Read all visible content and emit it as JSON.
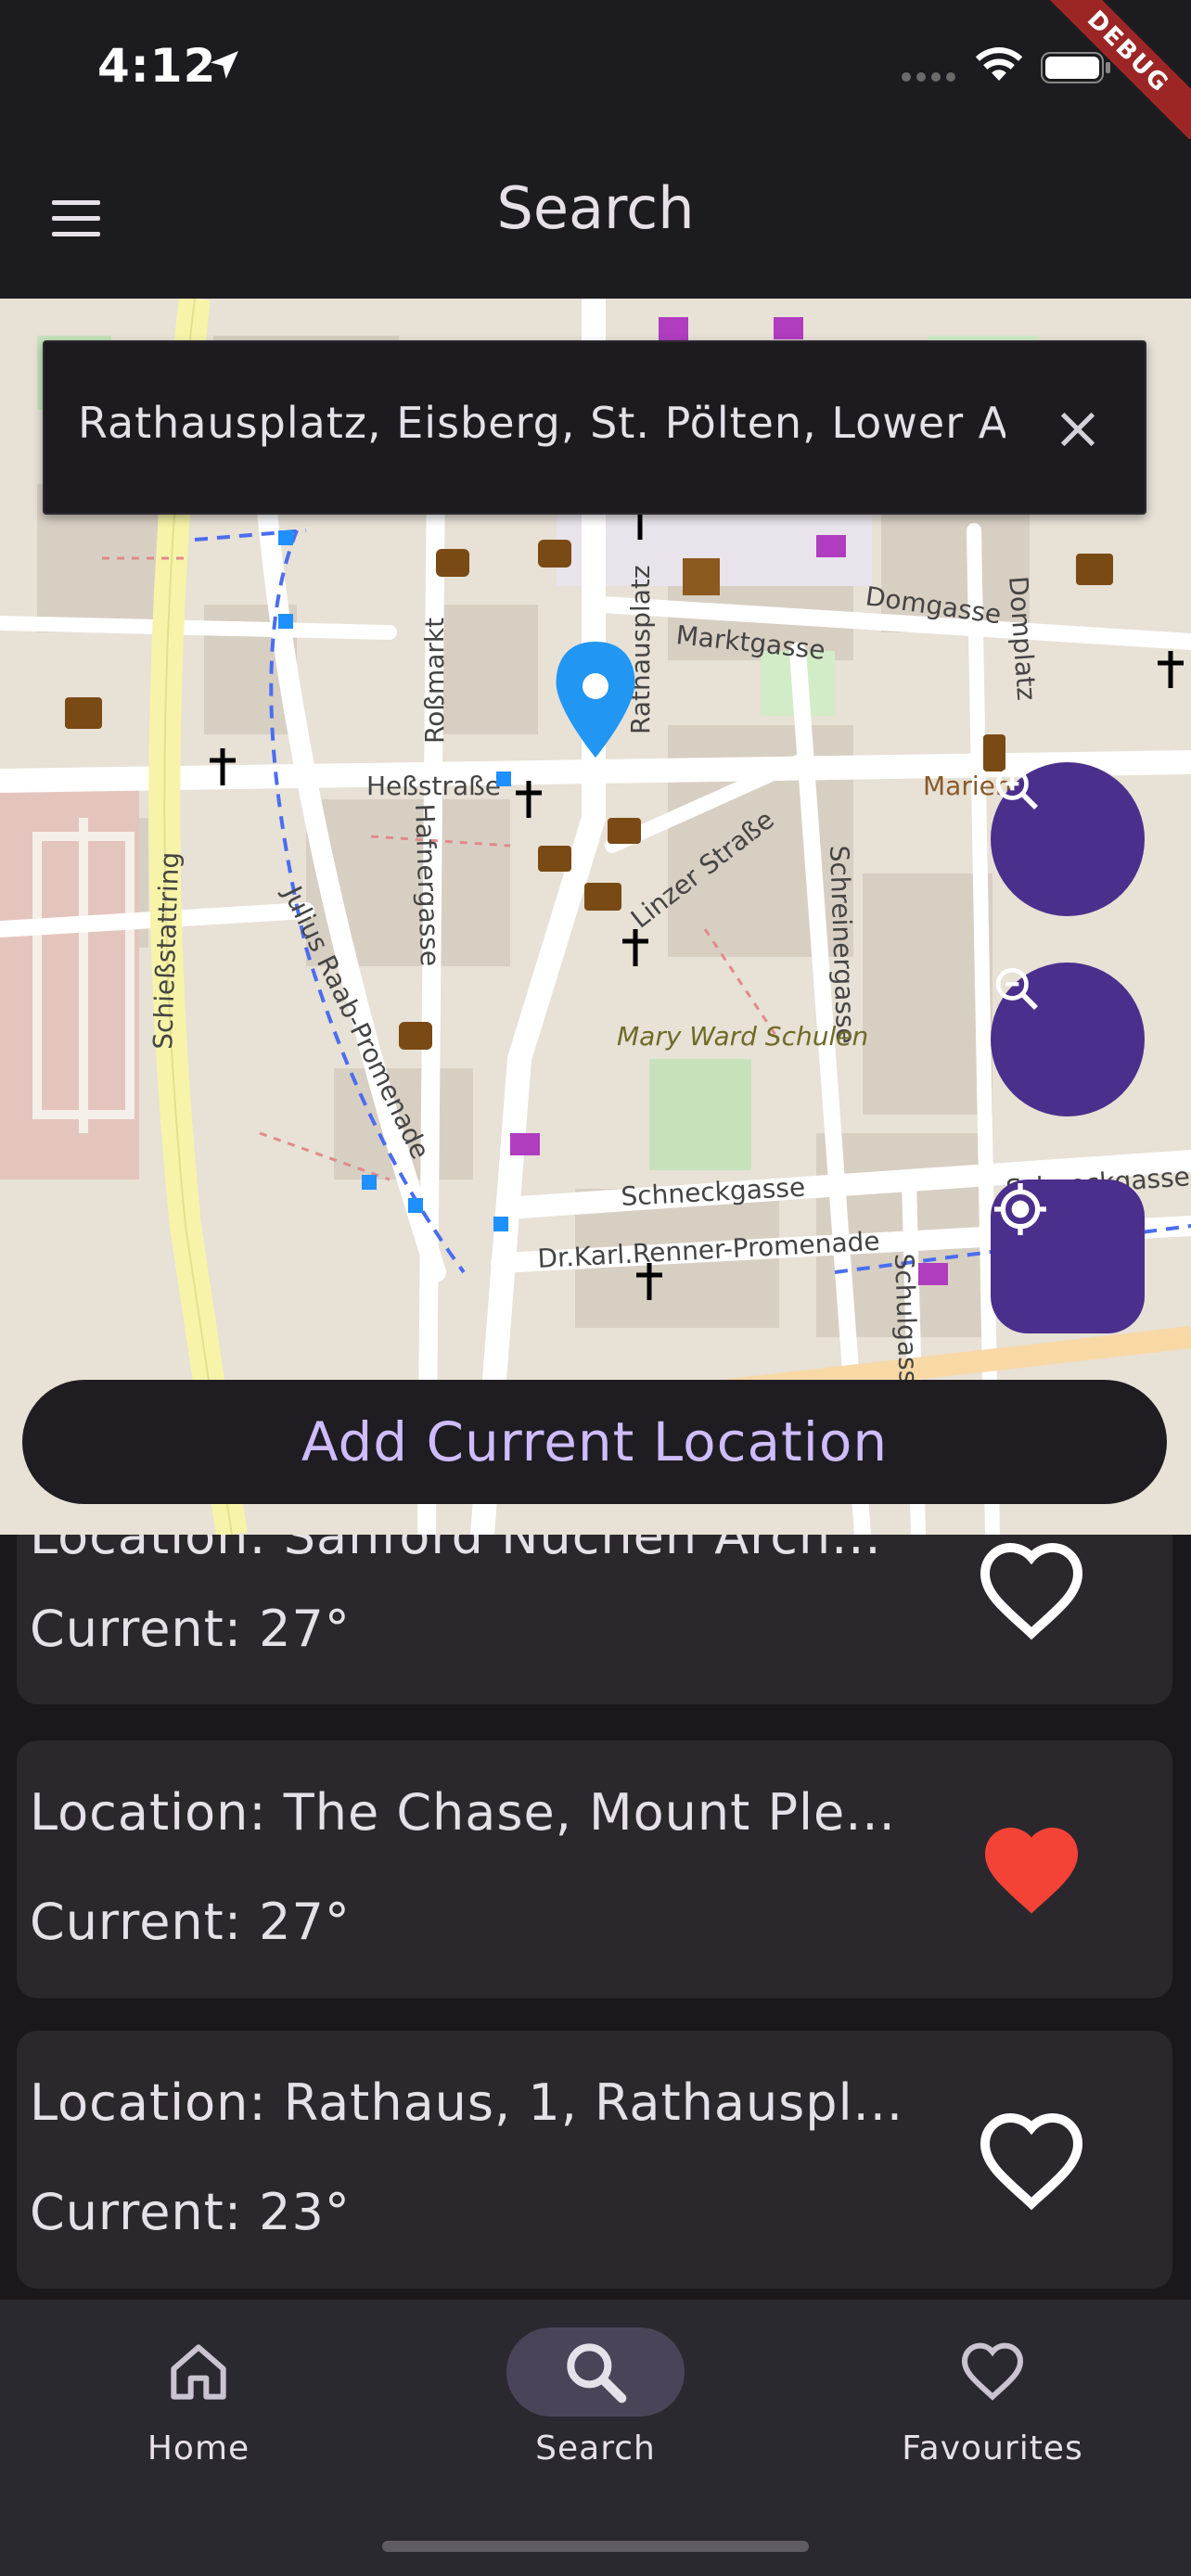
{
  "status_bar": {
    "time": "4:12",
    "debug_label": "DEBUG"
  },
  "app_bar": {
    "title": "Search"
  },
  "search": {
    "value": "Rathausplatz, Eisberg, St. Pölten, Lower Austria, Austria"
  },
  "map": {
    "street_labels": [
      "Heßstraße",
      "Roßmarkt",
      "Hafnergasse",
      "Julius Raab-Promenade",
      "Schießstattring",
      "Linzer Straße",
      "Schreinergasse",
      "Rathausplatz",
      "Marktgasse",
      "Domgasse",
      "Domplatz",
      "Schneckgasse",
      "Dr.Karl.Renner-Promenade",
      "Schulgasse",
      "Mary Ward Schulen",
      "Marien"
    ]
  },
  "fabs": {
    "zoom_in": "zoom-in",
    "zoom_out": "zoom-out",
    "locate": "my-location"
  },
  "add_button_label": "Add Current Location",
  "locations": [
    {
      "location": "Location: Sanford Nuchen Arch...",
      "current": "Current: 27°",
      "favourite": false
    },
    {
      "location": "Location: The Chase, Mount Ple...",
      "current": "Current: 27°",
      "favourite": true
    },
    {
      "location": "Location: Rathaus, 1, Rathauspl...",
      "current": "Current: 23°",
      "favourite": false
    }
  ],
  "nav": {
    "items": [
      {
        "label": "Home",
        "icon": "home-icon"
      },
      {
        "label": "Search",
        "icon": "search-icon",
        "active": true
      },
      {
        "label": "Favourites",
        "icon": "heart-icon"
      }
    ]
  },
  "colors": {
    "accent": "#4b2f8c",
    "accent_text": "#cfbcff",
    "favourite": "#f44336",
    "pin": "#2196f3"
  }
}
